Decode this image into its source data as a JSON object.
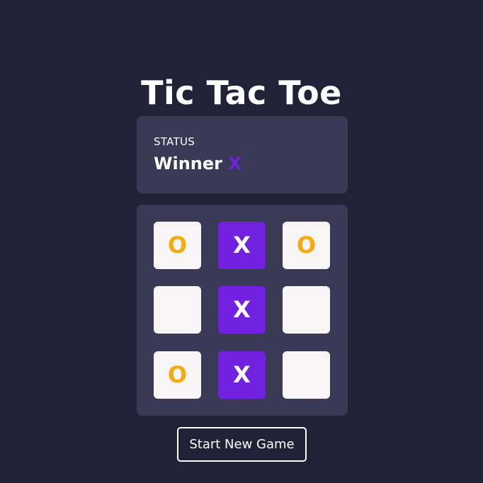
{
  "title": "Tic Tac Toe",
  "status": {
    "label": "STATUS",
    "text": "Winner",
    "winner": "X"
  },
  "board": {
    "cells": [
      "O",
      "X",
      "O",
      "",
      "X",
      "",
      "O",
      "X",
      ""
    ]
  },
  "new_game_label": "Start New Game",
  "colors": {
    "background": "#212137",
    "panel": "#3a3a56",
    "x_accent": "#7321e0",
    "o_accent": "#f7a910",
    "cell_empty": "#f7f5f6"
  }
}
